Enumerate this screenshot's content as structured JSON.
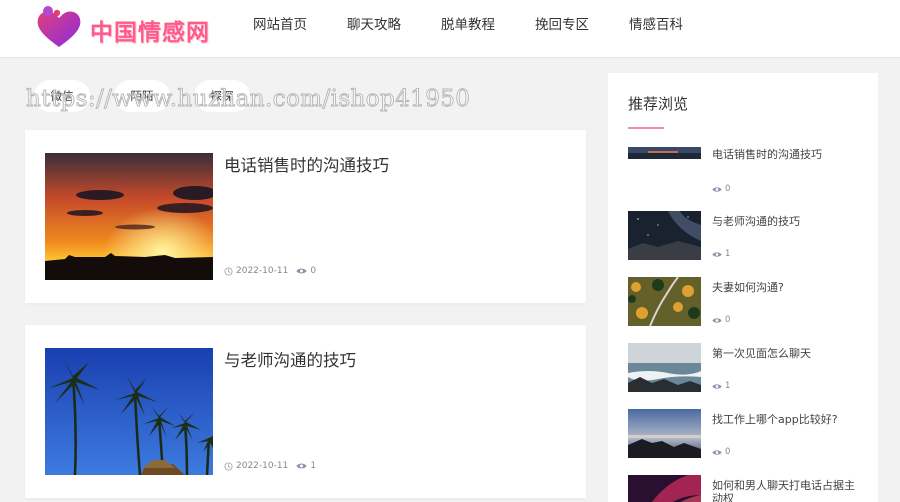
{
  "header": {
    "logo_text": "中国情感网",
    "nav": [
      "网站首页",
      "聊天攻略",
      "脱单教程",
      "挽回专区",
      "情感百科"
    ]
  },
  "tags": [
    "微信",
    "陌陌",
    "探探"
  ],
  "watermark": "https://www.huzhan.com/ishop41950",
  "posts": [
    {
      "title": "电话销售时的沟通技巧",
      "date": "2022-10-11",
      "views": "0"
    },
    {
      "title": "与老师沟通的技巧",
      "date": "2022-10-11",
      "views": "1"
    }
  ],
  "sidebar": {
    "title": "推荐浏览",
    "items": [
      {
        "title": "电话销售时的沟通技巧",
        "views": "0"
      },
      {
        "title": "与老师沟通的技巧",
        "views": "1"
      },
      {
        "title": "夫妻如何沟通?",
        "views": "0"
      },
      {
        "title": "第一次见面怎么聊天",
        "views": "1"
      },
      {
        "title": "找工作上哪个app比较好?",
        "views": "0"
      },
      {
        "title": "如何和男人聊天打电话占据主动权",
        "views": ""
      }
    ]
  },
  "colors": {
    "accent": "#ef8ea6",
    "logo": "#ff5a8c",
    "page_bg": "#f2f2f2"
  }
}
